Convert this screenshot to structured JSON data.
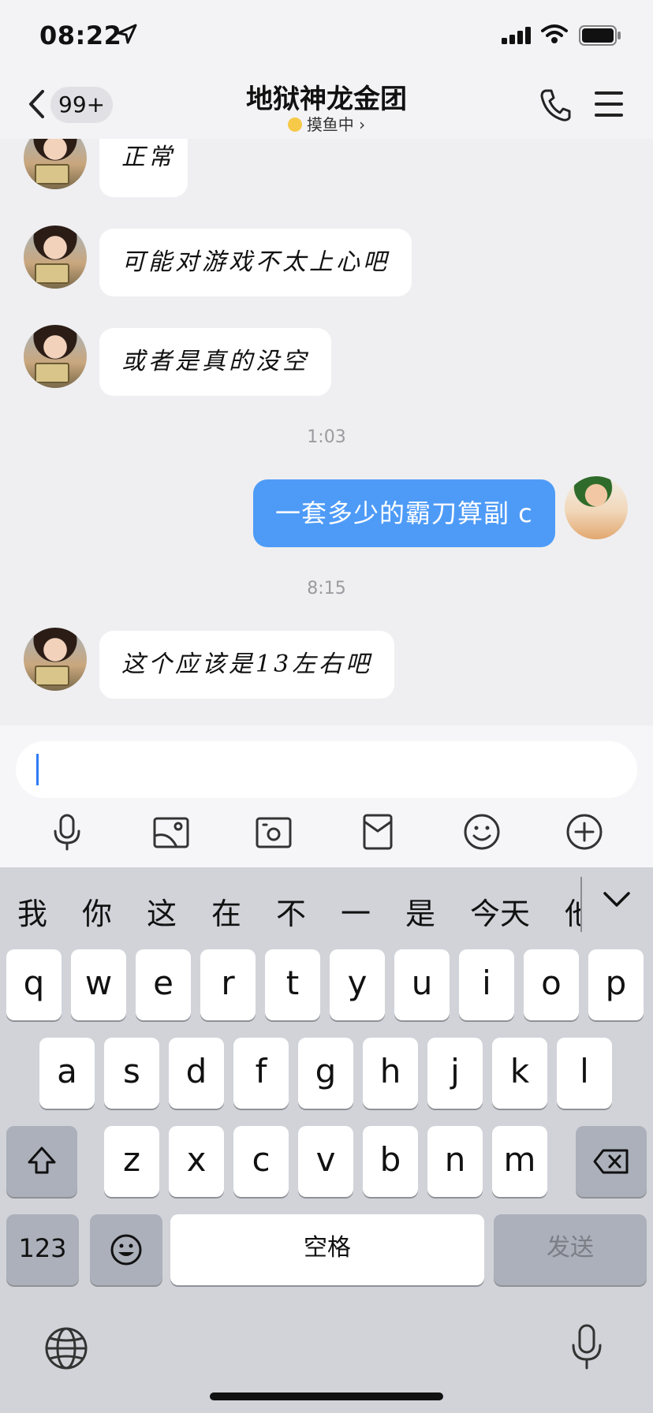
{
  "status_bar": {
    "time": "08:22"
  },
  "nav": {
    "back_badge": "99+",
    "title": "地狱神龙金团",
    "status": "摸鱼中 ›"
  },
  "messages": [
    {
      "side": "in",
      "text": "正常"
    },
    {
      "side": "in",
      "text": "可能对游戏不太上心吧"
    },
    {
      "side": "in",
      "text": "或者是真的没空"
    },
    {
      "type": "time",
      "text": "1:03"
    },
    {
      "side": "out",
      "text": "一套多少的霸刀算副 c"
    },
    {
      "type": "time",
      "text": "8:15"
    },
    {
      "side": "in",
      "text": "这个应该是13左右吧"
    }
  ],
  "input": {
    "value": "",
    "placeholder": ""
  },
  "toolbar": [
    "mic-icon",
    "image-icon",
    "camera-icon",
    "red-packet-icon",
    "emoji-icon",
    "plus-icon"
  ],
  "keyboard": {
    "candidates": [
      "我",
      "你",
      "这",
      "在",
      "不",
      "一",
      "是",
      "今天",
      "他"
    ],
    "row1": [
      "q",
      "w",
      "e",
      "r",
      "t",
      "y",
      "u",
      "i",
      "o",
      "p"
    ],
    "row2": [
      "a",
      "s",
      "d",
      "f",
      "g",
      "h",
      "j",
      "k",
      "l"
    ],
    "row3": [
      "z",
      "x",
      "c",
      "v",
      "b",
      "n",
      "m"
    ],
    "numbers_label": "123",
    "space_label": "空格",
    "send_label": "发送"
  },
  "colors": {
    "accent": "#4e9bf7",
    "keyboard_bg": "#d1d3d9"
  }
}
